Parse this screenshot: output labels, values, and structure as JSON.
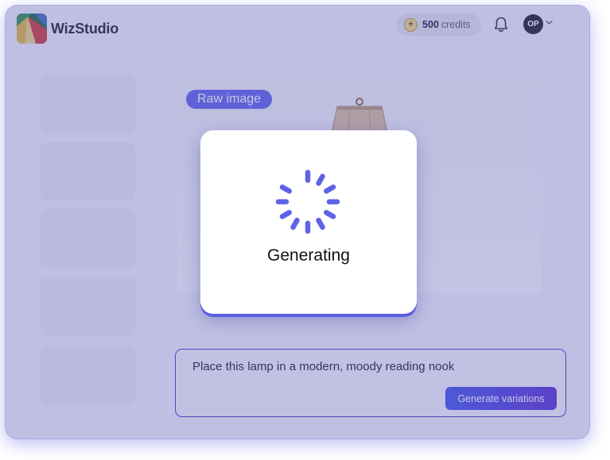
{
  "header": {
    "app_name": "WizStudio",
    "credits_amount": "500",
    "credits_unit": "credits",
    "coin_symbol": "+",
    "avatar_initials": "OP",
    "icons": [
      "logo-icon",
      "coin-icon",
      "bell-icon",
      "chevron-down-icon"
    ]
  },
  "sidebar": {
    "thumbnails": 5
  },
  "canvas": {
    "badge_label": "Raw image",
    "image_icon": "lamp-icon"
  },
  "prompt": {
    "text": "Place this lamp in a modern, moody reading nook",
    "button_label": "Generate variations"
  },
  "modal": {
    "status_label": "Generating",
    "icon": "spinner-icon"
  },
  "colors": {
    "accent": "#5e63e6",
    "button_gradient_start": "#3f55e8",
    "button_gradient_end": "#5a2fd0",
    "overlay": "#6060ba"
  }
}
